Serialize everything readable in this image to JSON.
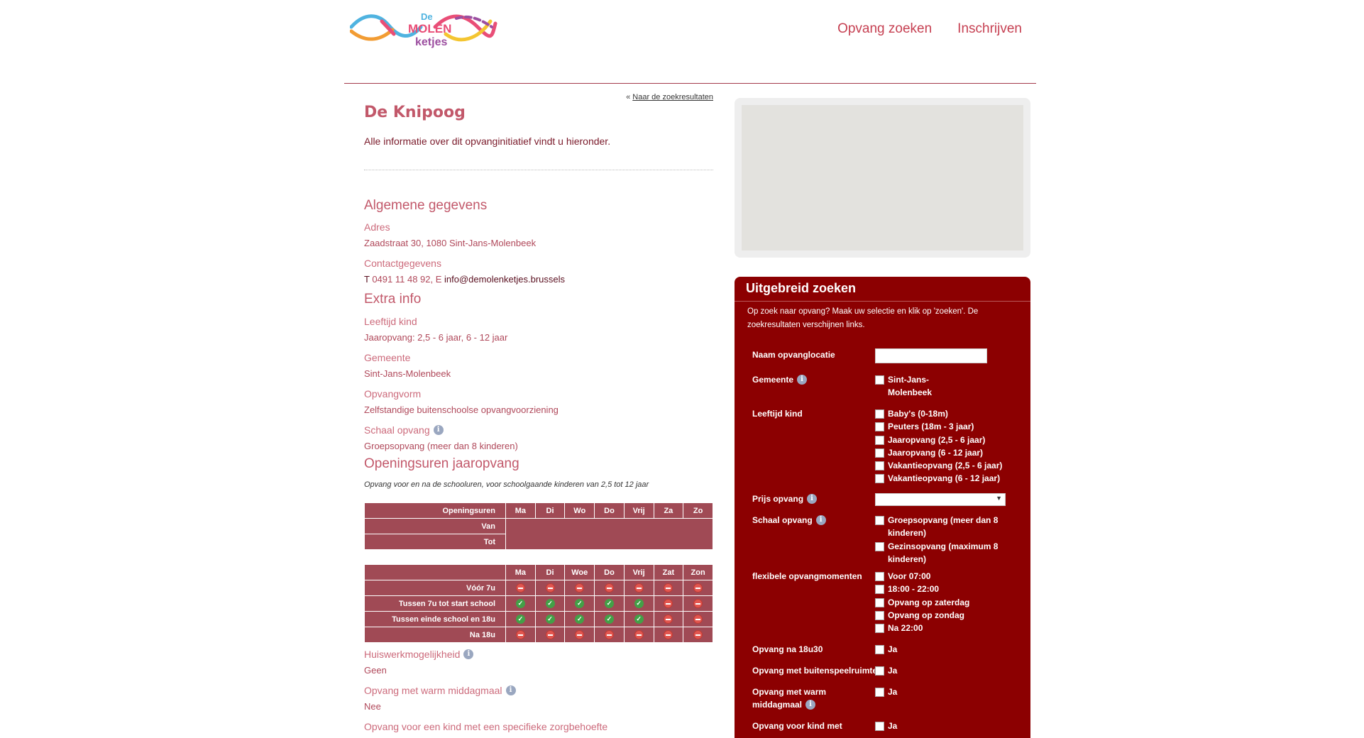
{
  "header": {
    "logo_text": "De Molen ketjes",
    "nav": [
      "Opvang zoeken",
      "Inschrijven"
    ]
  },
  "detail": {
    "back_prefix": "« ",
    "back_link": "Naar de zoekresultaten",
    "title": "De Knipoog",
    "intro": "Alle informatie over dit opvanginitiatief vindt u hieronder.",
    "algemeen": {
      "heading": "Algemene gegevens",
      "adres_label": "Adres",
      "adres_value": "Zaadstraat 30, 1080 Sint-Jans-Molenbeek",
      "contact_label": "Contactgegevens",
      "contact_t": "T",
      "contact_phone": " 0491 11 48 92, E ",
      "contact_email": "info@demolenketjes.brussels"
    },
    "extra": {
      "heading": "Extra info",
      "leeftijd_label": "Leeftijd kind",
      "leeftijd_value": "Jaaropvang: 2,5 - 6 jaar, 6 - 12 jaar",
      "gemeente_label": "Gemeente",
      "gemeente_value": "Sint-Jans-Molenbeek",
      "opvangvorm_label": "Opvangvorm",
      "opvangvorm_value": "Zelfstandige buitenschoolse opvangvoorziening",
      "schaal_label": "Schaal opvang",
      "schaal_value": "Groepsopvang (meer dan 8 kinderen)"
    },
    "openingsuren": {
      "heading": "Openingsuren jaaropvang",
      "note": "Opvang voor en na de schooluren, voor schoolgaande kinderen van 2,5 tot 12 jaar",
      "table1": {
        "corner": "Openingsuren",
        "days": [
          "Ma",
          "Di",
          "Wo",
          "Do",
          "Vrij",
          "Za",
          "Zo"
        ],
        "rows": [
          "Van",
          "Tot"
        ]
      },
      "table2": {
        "days": [
          "Ma",
          "Di",
          "Woe",
          "Do",
          "Vrij",
          "Zat",
          "Zon"
        ],
        "rows": [
          {
            "label": "Vóór 7u",
            "status": [
              "closed",
              "closed",
              "closed",
              "closed",
              "closed",
              "closed",
              "closed"
            ]
          },
          {
            "label": "Tussen 7u tot start school",
            "status": [
              "open",
              "open",
              "open",
              "open",
              "open",
              "closed",
              "closed"
            ]
          },
          {
            "label": "Tussen einde school en 18u",
            "status": [
              "open",
              "open",
              "open",
              "open",
              "open",
              "closed",
              "closed"
            ]
          },
          {
            "label": "Na 18u",
            "status": [
              "closed",
              "closed",
              "closed",
              "closed",
              "closed",
              "closed",
              "closed"
            ]
          }
        ]
      }
    },
    "huiswerk_label": "Huiswerkmogelijkheid",
    "huiswerk_value": "Geen",
    "middagmaal_label": "Opvang met warm middagmaal",
    "middagmaal_value": "Nee",
    "zorg_label": "Opvang voor een kind met een specifieke zorgbehoefte"
  },
  "search": {
    "title": "Uitgebreid zoeken",
    "intro": "Op zoek naar opvang? Maak uw selectie en klik op 'zoeken'. De zoekresultaten verschijnen links.",
    "naam_label": "Naam opvanglocatie",
    "naam_value": "",
    "gemeente_label": "Gemeente",
    "gemeente_options": [
      "Sint-Jans-Molenbeek"
    ],
    "leeftijd_label": "Leeftijd kind",
    "leeftijd_options": [
      "Baby's (0-18m)",
      "Peuters (18m - 3 jaar)",
      "Jaaropvang (2,5 - 6 jaar)",
      "Jaaropvang (6 - 12 jaar)",
      "Vakantieopvang (2,5 - 6 jaar)",
      "Vakantieopvang (6 - 12 jaar)"
    ],
    "prijs_label": "Prijs opvang",
    "prijs_value": "",
    "schaal_label": "Schaal opvang",
    "schaal_options": [
      "Groepsopvang (meer dan 8 kinderen)",
      "Gezinsopvang (maximum 8 kinderen)"
    ],
    "flex_label": "flexibele opvangmomenten",
    "flex_options": [
      "Voor 07:00",
      "18:00 - 22:00",
      "Opvang op zaterdag",
      "Opvang op zondag",
      "Na 22:00"
    ],
    "na1830_label": "Opvang na 18u30",
    "buiten_label": "Opvang met buitenspeelruimte",
    "warm_label_1": "Opvang met warm",
    "warm_label_2": "middagmaal",
    "zorg_label": "Opvang voor kind met",
    "ja": "Ja"
  }
}
